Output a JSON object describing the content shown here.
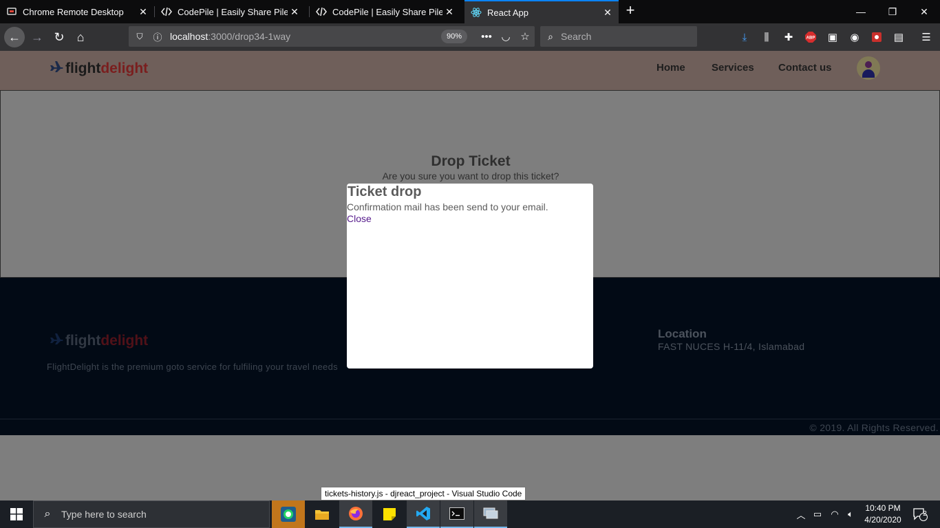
{
  "browser": {
    "tabs": [
      {
        "title": "Chrome Remote Desktop",
        "favicon": "chrome-remote-desktop-icon",
        "active": false
      },
      {
        "title": "CodePile | Easily Share Piles of Code",
        "favicon": "codepile-icon",
        "active": false
      },
      {
        "title": "CodePile | Easily Share Piles of Code",
        "favicon": "codepile-icon",
        "active": false
      },
      {
        "title": "React App",
        "favicon": "react-icon",
        "active": true
      }
    ],
    "url_host": "localhost",
    "url_path": ":3000/drop34-1way",
    "zoom": "90%",
    "search_placeholder": "Search"
  },
  "site": {
    "logo_part1": "flight",
    "logo_part2": "delight",
    "nav": [
      "Home",
      "Services",
      "Contact us"
    ]
  },
  "drop": {
    "title": "Drop Ticket",
    "subtitle": "Are you sure you want to drop this ticket?"
  },
  "modal": {
    "title": "Ticket drop",
    "body": "Confirmation mail has been send to your email.",
    "close": "Close"
  },
  "footer": {
    "description": "FlightDelight is the premium goto service for fulfiling your travel needs",
    "location_title": "Location",
    "location": "FAST NUCES H-11/4, Islamabad",
    "copyright": "© 2019. All Rights Reserved."
  },
  "taskbar": {
    "search_placeholder": "Type here to search",
    "tooltip": "tickets-history.js - djreact_project - Visual Studio Code",
    "time": "10:40 PM",
    "date": "4/20/2020",
    "notifications": "2"
  },
  "colors": {
    "accent_blue": "#0a84ff",
    "logo_red": "#7a1e1e",
    "footer_bg": "#020a15",
    "modal_link": "#551a8b"
  }
}
